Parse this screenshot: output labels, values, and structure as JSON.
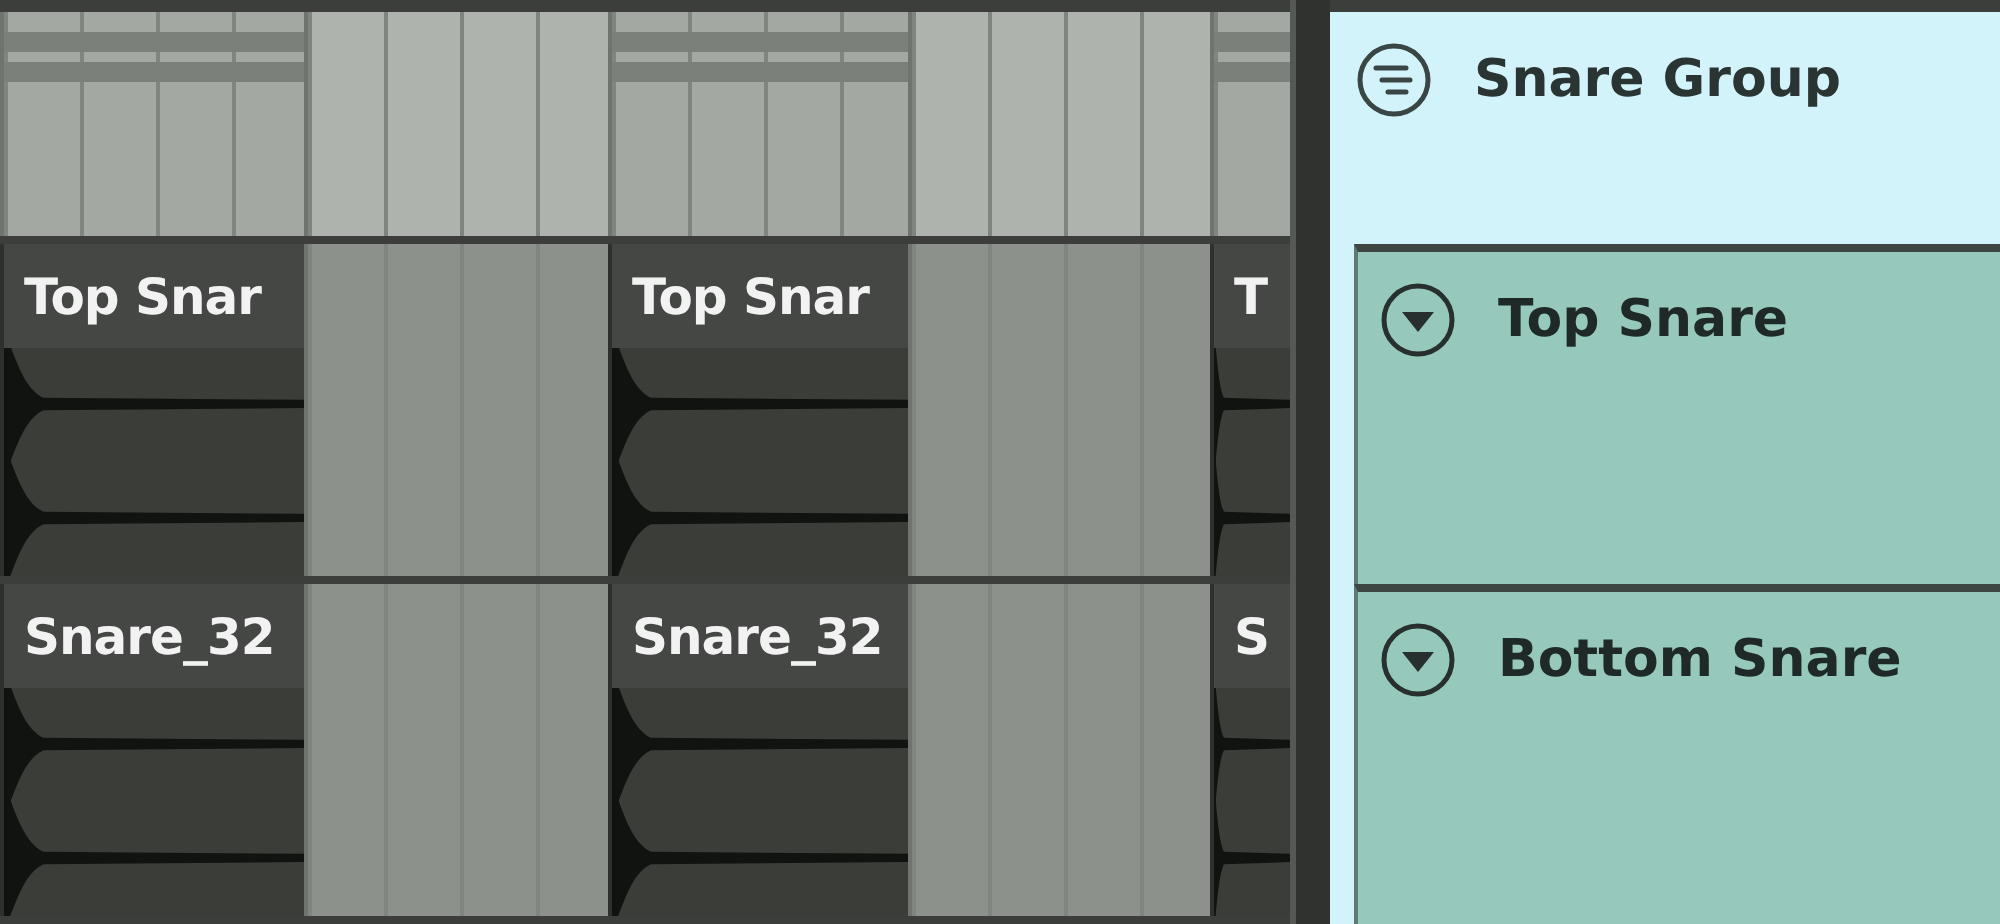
{
  "group_track": {
    "name": "Snare Group"
  },
  "tracks": [
    {
      "name": "Top Snare",
      "clips": [
        {
          "label": "Top Snar"
        },
        {
          "label": "Top Snar"
        },
        {
          "label": "T"
        }
      ]
    },
    {
      "name": "Bottom Snare",
      "clips": [
        {
          "label": "Snare_32"
        },
        {
          "label": "Snare_32"
        },
        {
          "label": "S"
        }
      ]
    }
  ]
}
